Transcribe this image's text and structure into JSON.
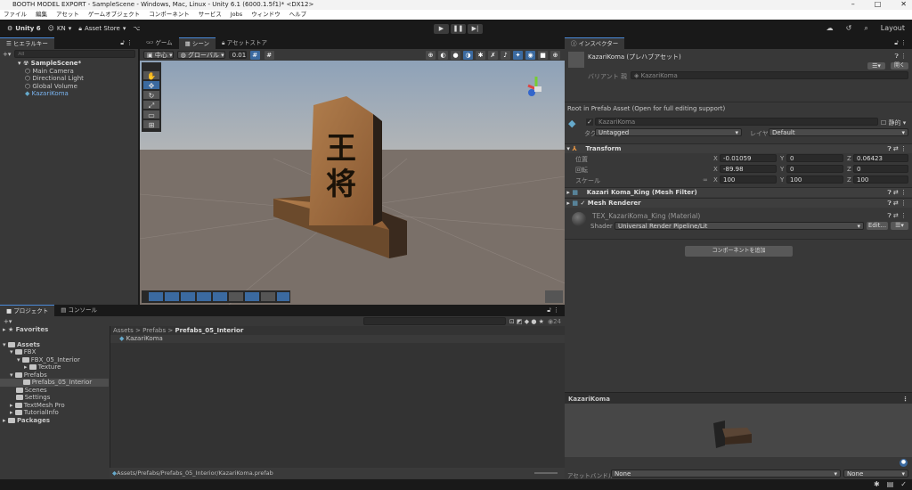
{
  "window": {
    "title": "BOOTH MODEL EXPORT - SampleScene - Windows, Mac, Linux - Unity 6.1 (6000.1.5f1)* <DX12>",
    "controls": [
      "–",
      "□",
      "✕"
    ]
  },
  "menu": [
    "ファイル",
    "編集",
    "アセット",
    "ゲームオブジェクト",
    "コンポーネント",
    "サービス",
    "Jobs",
    "ウィンドウ",
    "ヘルプ"
  ],
  "toolbar": {
    "unity": "Unity 6",
    "account": "KN",
    "asset_store": "Asset Store",
    "layout": "Layout"
  },
  "hierarchy": {
    "tab": "ヒエラルキー",
    "search_placeholder": "All",
    "scene": "SampleScene*",
    "items": [
      "Main Camera",
      "Directional Light",
      "Global Volume",
      "KazariKoma"
    ]
  },
  "scene_tabs": [
    "ゲーム",
    "シーン",
    "アセットストア"
  ],
  "scene_toolbar": {
    "pivot": "中心",
    "space": "グローバル",
    "snap": "0.01"
  },
  "inspector": {
    "tab": "インスペクター",
    "asset_title": "KazariKoma (プレハブアセット)",
    "open": "開く",
    "variant_label": "バリアント 親",
    "variant_value": "KazariKoma",
    "notice": "Root in Prefab Asset (Open for full editing support)",
    "name": "KazariKoma",
    "static": "静的",
    "tag_label": "タグ",
    "tag": "Untagged",
    "layer_label": "レイヤー",
    "layer": "Default",
    "transform": {
      "title": "Transform",
      "rows": [
        {
          "label": "位置",
          "x": "-0.01059",
          "y": "0",
          "z": "0.06423"
        },
        {
          "label": "回転",
          "x": "-89.98",
          "y": "0",
          "z": "0"
        },
        {
          "label": "スケール",
          "x": "100",
          "y": "100",
          "z": "100"
        }
      ]
    },
    "mesh_filter": "Kazari Koma_King (Mesh Filter)",
    "mesh_renderer": "Mesh Renderer",
    "material": "TEX_KazariKoma_King (Material)",
    "shader_label": "Shader",
    "shader": "Universal Render Pipeline/Lit",
    "edit": "Edit...",
    "add_component": "コンポーネントを追加",
    "preview_title": "KazariKoma",
    "bundle_label": "アセットバンドル",
    "bundle": "None",
    "variant": "None"
  },
  "project": {
    "tabs": [
      "プロジェクト",
      "コンソール"
    ],
    "count": "24",
    "favorites": "Favorites",
    "tree": [
      {
        "label": "Assets",
        "d": 0,
        "bold": true
      },
      {
        "label": "FBX",
        "d": 1
      },
      {
        "label": "FBX_05_Interior",
        "d": 2
      },
      {
        "label": "Texture",
        "d": 3
      },
      {
        "label": "Prefabs",
        "d": 1
      },
      {
        "label": "Prefabs_05_Interior",
        "d": 2,
        "sel": true
      },
      {
        "label": "Scenes",
        "d": 1
      },
      {
        "label": "Settings",
        "d": 1
      },
      {
        "label": "TextMesh Pro",
        "d": 1
      },
      {
        "label": "TutorialInfo",
        "d": 1
      },
      {
        "label": "Packages",
        "d": 0,
        "bold": true
      }
    ],
    "breadcrumb": [
      "Assets",
      "Prefabs",
      "Prefabs_05_Interior"
    ],
    "sep": ">",
    "file": "KazariKoma",
    "path": "Assets/Prefabs/Prefabs_05_Interior/KazariKoma.prefab"
  },
  "colors": {
    "accent": "#4a8ad9",
    "selection": "#2c5d87",
    "panel": "#383838"
  }
}
